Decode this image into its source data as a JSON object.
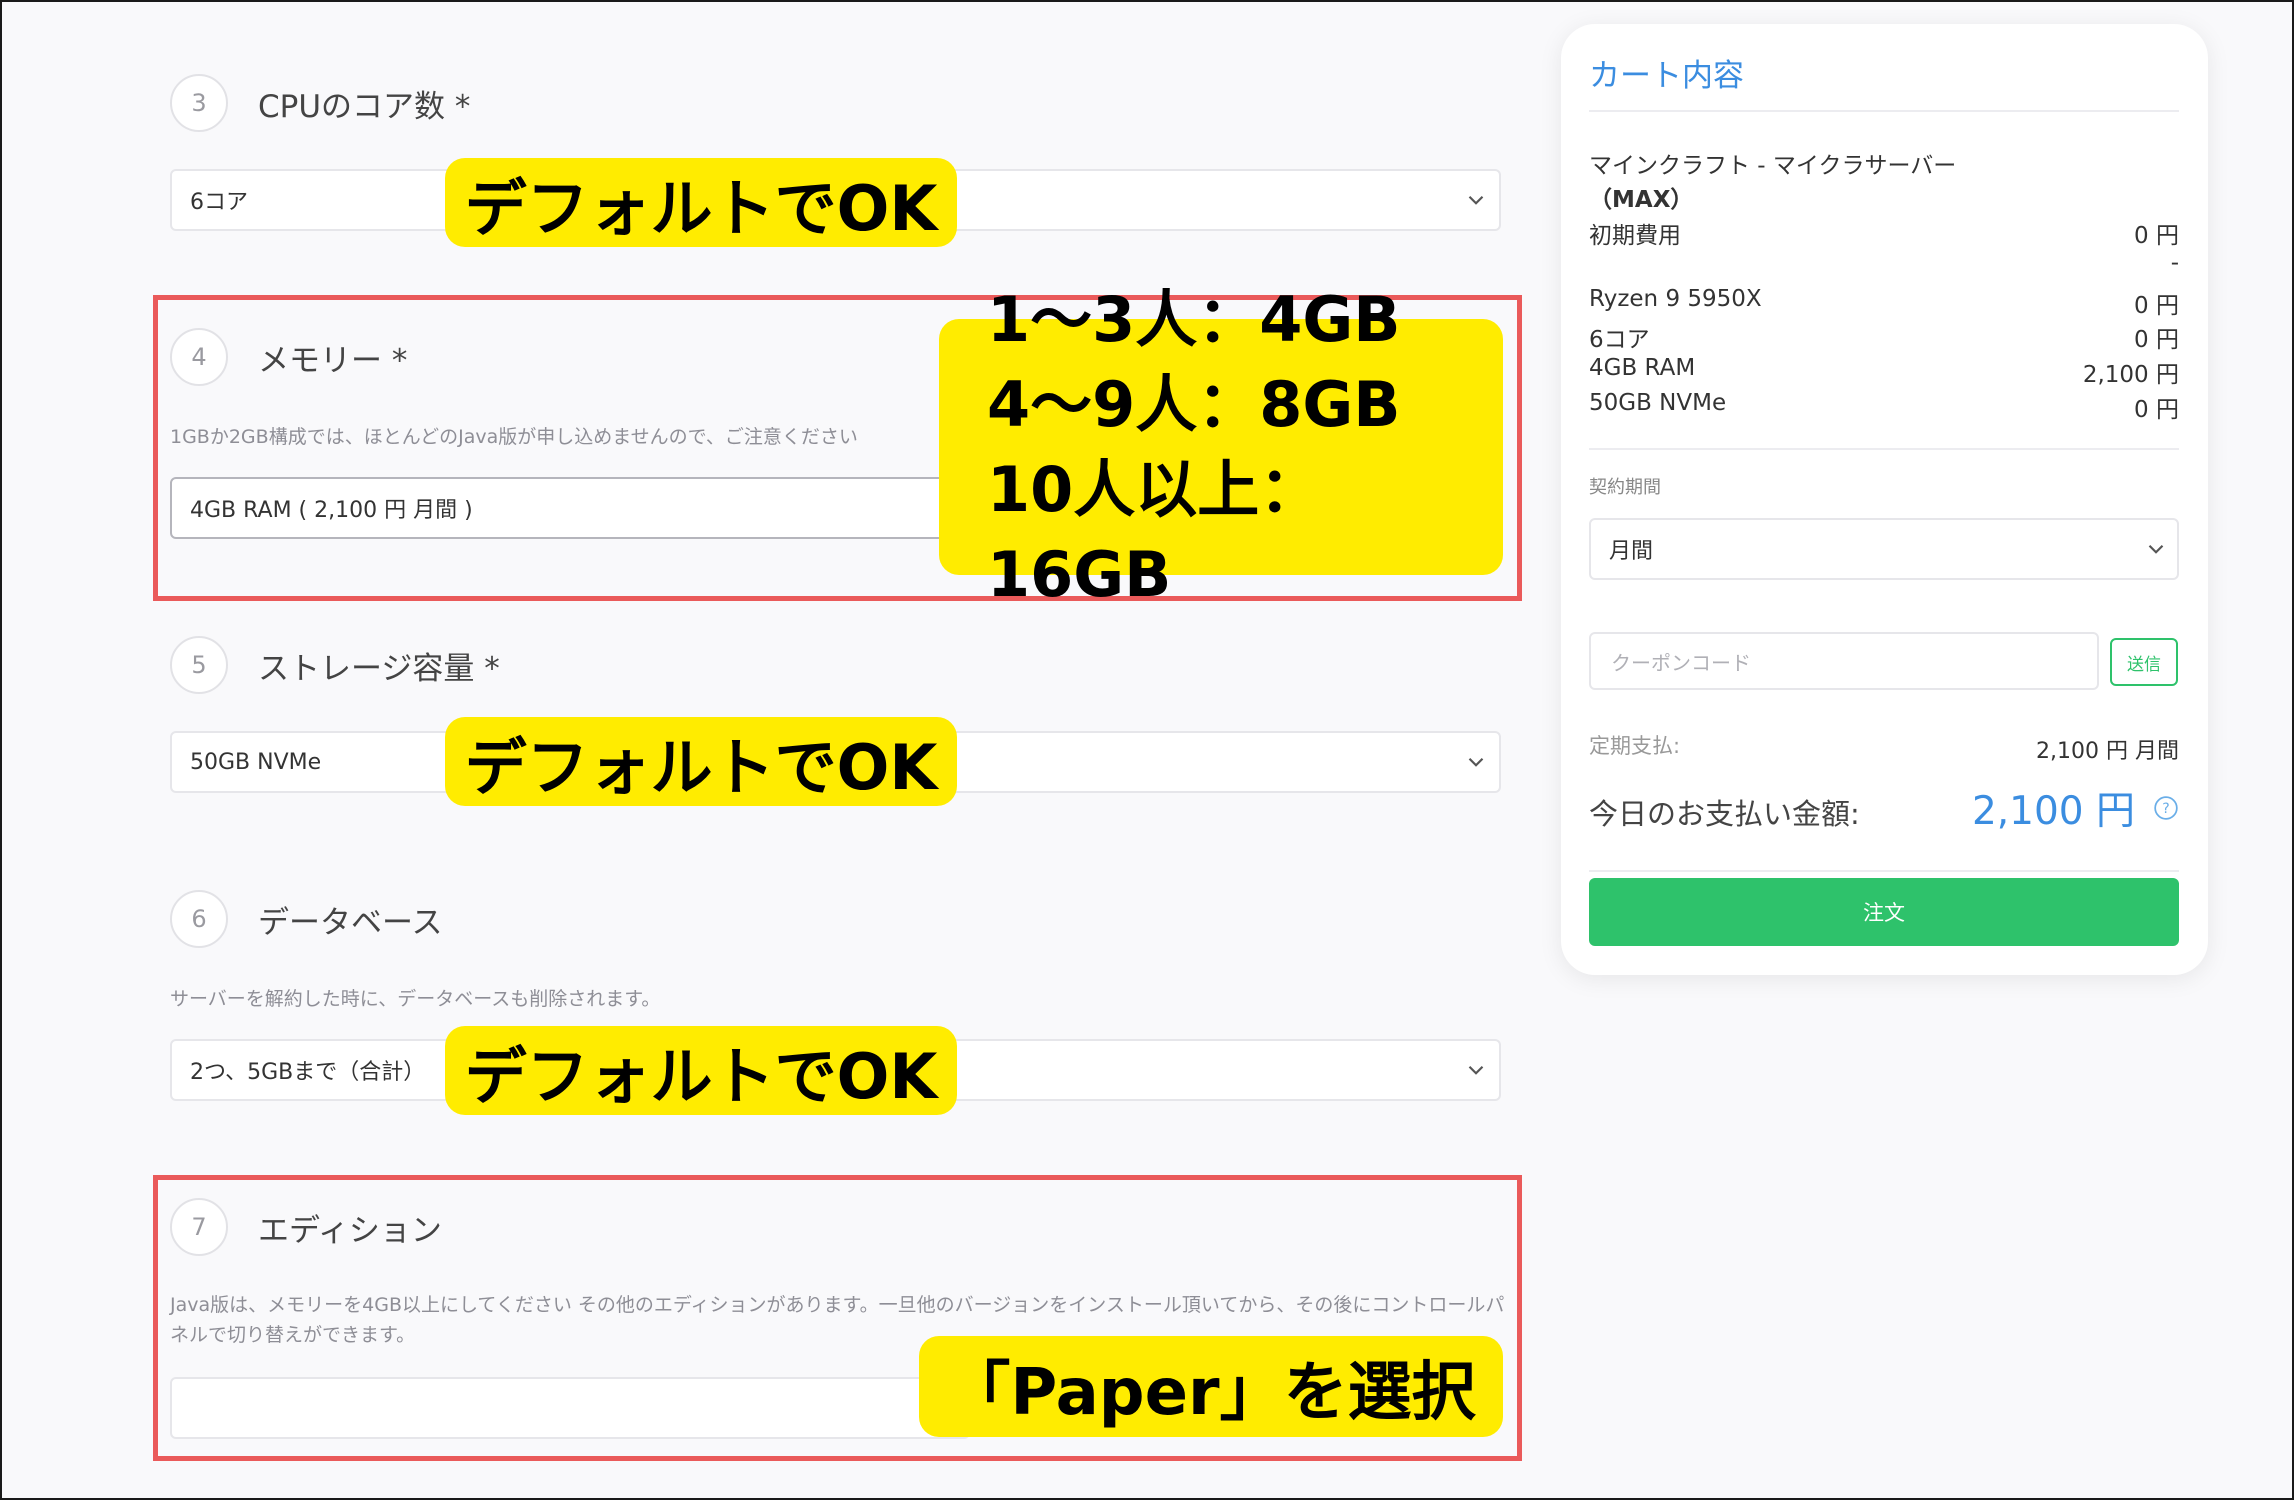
{
  "steps": [
    {
      "num": "3",
      "title": "CPUのコア数 *",
      "select": "6コア"
    },
    {
      "num": "4",
      "title": "メモリー *",
      "note": "1GBか2GB構成では、ほとんどのJava版が申し込めませんので、ご注意ください",
      "select": "4GB RAM ( 2,100 円 月間 )"
    },
    {
      "num": "5",
      "title": "ストレージ容量 *",
      "select": "50GB NVMe"
    },
    {
      "num": "6",
      "title": "データベース",
      "note": "サーバーを解約した時に、データベースも削除されます。",
      "select": "2つ、5GBまで（合計）"
    },
    {
      "num": "7",
      "title": "エディション",
      "note": "Java版は、メモリーを4GB以上にしてください その他のエディションがあります。一旦他のバージョンをインストール頂いてから、その後にコントロールパネルで切り替えができます。",
      "select": ""
    }
  ],
  "callouts": {
    "default_ok": "デフォルトでOK",
    "memory_lines": [
      "1〜3人：4GB",
      "4〜9人：8GB",
      "10人以上：16GB"
    ],
    "paper": "「Paper」を選択"
  },
  "cart": {
    "title": "カート内容",
    "product_line1": "マインクラフト - マイクラサーバー",
    "product_line2": "（MAX）",
    "items": [
      {
        "name": "初期費用",
        "value": "0 円"
      },
      {
        "name": "",
        "value": "-"
      },
      {
        "name": "Ryzen 9 5950X",
        "value": "0 円"
      },
      {
        "name": "6コア",
        "value": "0 円"
      },
      {
        "name": "4GB RAM",
        "value": "2,100 円"
      },
      {
        "name": "50GB NVMe",
        "value": "0 円"
      }
    ],
    "period_label": "契約期間",
    "period_value": "月間",
    "coupon_placeholder": "クーポンコード",
    "send_label": "送信",
    "recurring_label": "定期支払:",
    "recurring_value": "2,100 円  月間",
    "today_label": "今日のお支払い金額:",
    "today_value": "2,100 円",
    "order_label": "注文"
  },
  "colors": {
    "callout": "#ffec00",
    "highlight_border": "#ea5a5a",
    "accent_blue": "#3b8de0",
    "accent_green": "#2ec26b"
  },
  "icons": {
    "select": "chevron-down-icon",
    "help": "question-icon"
  }
}
